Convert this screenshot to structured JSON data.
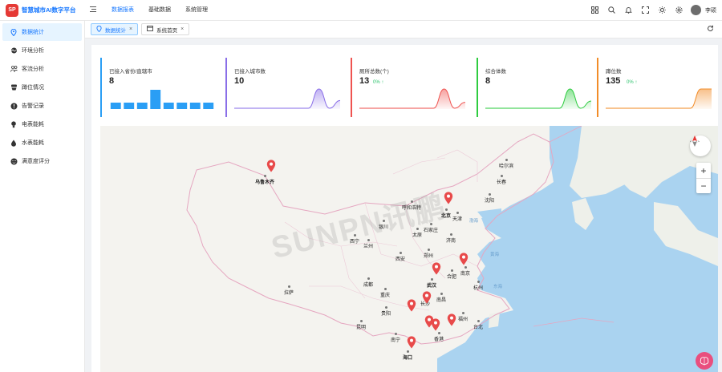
{
  "app": {
    "logo_text": "智慧城市AI数字平台",
    "logo_mark": "SP"
  },
  "topnav": [
    {
      "label": "数据报表",
      "active": true
    },
    {
      "label": "基础数据",
      "active": false
    },
    {
      "label": "系统管理",
      "active": false
    }
  ],
  "user": {
    "name": "李硕"
  },
  "sidebar": [
    {
      "label": "数据统计",
      "icon": "map-pin-icon",
      "active": true
    },
    {
      "label": "环境分析",
      "icon": "cloud-icon",
      "active": false
    },
    {
      "label": "客流分析",
      "icon": "people-icon",
      "active": false
    },
    {
      "label": "蹲位情况",
      "icon": "toilet-icon",
      "active": false
    },
    {
      "label": "告警记录",
      "icon": "alert-icon",
      "active": false
    },
    {
      "label": "电表能耗",
      "icon": "bulb-icon",
      "active": false
    },
    {
      "label": "水表能耗",
      "icon": "drop-icon",
      "active": false
    },
    {
      "label": "满意度评分",
      "icon": "smile-icon",
      "active": false
    }
  ],
  "tabs": [
    {
      "label": "数据统计",
      "active": true
    },
    {
      "label": "系统首页",
      "active": false
    }
  ],
  "cards": [
    {
      "title": "已接入省份/直辖市",
      "value": "8",
      "trend": "",
      "color": "#2a9ef5"
    },
    {
      "title": "已接入城市数",
      "value": "10",
      "trend": "",
      "color": "#8a6fe8"
    },
    {
      "title": "厕所总数(个)",
      "value": "13",
      "trend": "0% ↑",
      "color": "#ef5350"
    },
    {
      "title": "综合体数",
      "value": "8",
      "trend": "",
      "color": "#2ecc40"
    },
    {
      "title": "蹲位数",
      "value": "135",
      "trend": "0% ↑",
      "color": "#f28c28"
    }
  ],
  "chart_data": [
    {
      "type": "bar",
      "title": "已接入省份/直辖市",
      "categories": [
        "1",
        "2",
        "3",
        "4",
        "5",
        "6",
        "7",
        "8"
      ],
      "values": [
        1,
        1,
        1,
        3,
        1,
        1,
        1,
        1
      ]
    },
    {
      "type": "area",
      "title": "已接入城市数",
      "x": [
        0,
        1,
        2,
        3,
        4,
        5,
        6,
        7,
        8,
        9,
        10
      ],
      "values": [
        0,
        0,
        0,
        0,
        0,
        0,
        0,
        0,
        10,
        0,
        4
      ]
    },
    {
      "type": "area",
      "title": "厕所总数(个)",
      "x": [
        0,
        1,
        2,
        3,
        4,
        5,
        6,
        7,
        8,
        9,
        10
      ],
      "values": [
        0,
        0,
        0,
        0,
        0,
        0,
        0,
        0,
        13,
        0,
        4
      ]
    },
    {
      "type": "area",
      "title": "综合体数",
      "x": [
        0,
        1,
        2,
        3,
        4,
        5,
        6,
        7,
        8,
        9,
        10
      ],
      "values": [
        0,
        0,
        0,
        0,
        0,
        0,
        0,
        0,
        8,
        0,
        3
      ]
    },
    {
      "type": "area",
      "title": "蹲位数",
      "x": [
        0,
        1,
        2,
        3,
        4,
        5,
        6,
        7,
        8,
        9,
        10
      ],
      "values": [
        0,
        0,
        0,
        0,
        0,
        0,
        0,
        0,
        0,
        5,
        5
      ]
    }
  ],
  "map": {
    "watermark": "SUNPN讯鹏",
    "cities": [
      {
        "name": "乌鲁木齐",
        "bold": true
      },
      {
        "name": "哈尔滨"
      },
      {
        "name": "长春"
      },
      {
        "name": "沈阳"
      },
      {
        "name": "呼和浩特"
      },
      {
        "name": "北京",
        "bold": true
      },
      {
        "name": "天津"
      },
      {
        "name": "石家庄"
      },
      {
        "name": "济南"
      },
      {
        "name": "银川"
      },
      {
        "name": "西宁"
      },
      {
        "name": "兰州"
      },
      {
        "name": "太原"
      },
      {
        "name": "郑州"
      },
      {
        "name": "西安"
      },
      {
        "name": "合肥"
      },
      {
        "name": "南京"
      },
      {
        "name": "武汉",
        "bold": true
      },
      {
        "name": "杭州"
      },
      {
        "name": "成都"
      },
      {
        "name": "重庆"
      },
      {
        "name": "长沙"
      },
      {
        "name": "南昌"
      },
      {
        "name": "拉萨"
      },
      {
        "name": "贵阳"
      },
      {
        "name": "福州"
      },
      {
        "name": "台北"
      },
      {
        "name": "昆明"
      },
      {
        "name": "南宁"
      },
      {
        "name": "香港"
      },
      {
        "name": "海口",
        "bold": true
      }
    ],
    "seas": [
      "渤海",
      "黄海",
      "东海"
    ]
  }
}
